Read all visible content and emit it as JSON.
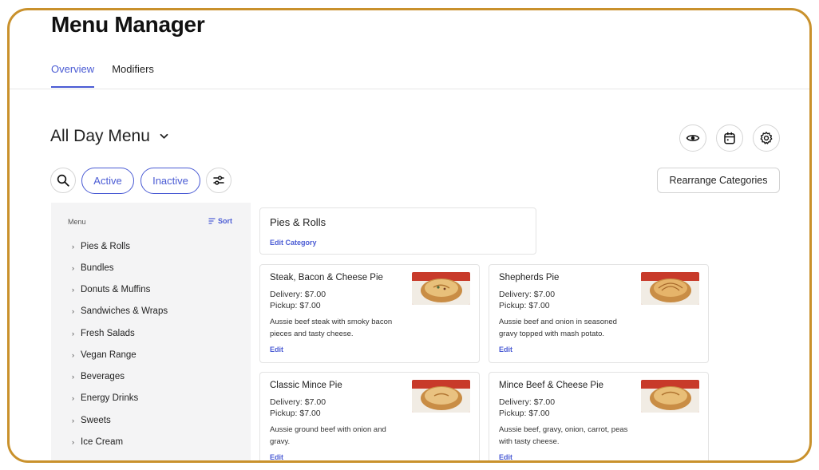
{
  "header": {
    "title": "Menu Manager"
  },
  "tabs": [
    {
      "label": "Overview"
    },
    {
      "label": "Modifiers"
    }
  ],
  "menu": {
    "title": "All Day Menu"
  },
  "filters": {
    "active": "Active",
    "inactive": "Inactive"
  },
  "actions": {
    "rearrange": "Rearrange Categories"
  },
  "sidebar": {
    "heading": "Menu",
    "sort_label": "Sort",
    "items": [
      {
        "label": "Pies & Rolls"
      },
      {
        "label": "Bundles"
      },
      {
        "label": "Donuts & Muffins"
      },
      {
        "label": "Sandwiches & Wraps"
      },
      {
        "label": "Fresh Salads"
      },
      {
        "label": "Vegan Range"
      },
      {
        "label": "Beverages"
      },
      {
        "label": "Energy Drinks"
      },
      {
        "label": "Sweets"
      },
      {
        "label": "Ice Cream"
      }
    ]
  },
  "category": {
    "name": "Pies & Rolls",
    "edit_label": "Edit Category"
  },
  "items": [
    {
      "name": "Steak, Bacon & Cheese Pie",
      "delivery": "Delivery: $7.00",
      "pickup": "Pickup: $7.00",
      "description": "Aussie beef steak with smoky bacon pieces and tasty cheese.",
      "edit": "Edit"
    },
    {
      "name": "Shepherds Pie",
      "delivery": "Delivery: $7.00",
      "pickup": "Pickup: $7.00",
      "description": "Aussie beef and onion in seasoned gravy topped with mash potato.",
      "edit": "Edit"
    },
    {
      "name": "Classic Mince Pie",
      "delivery": "Delivery: $7.00",
      "pickup": "Pickup: $7.00",
      "description": "Aussie ground beef with onion and gravy.",
      "edit": "Edit"
    },
    {
      "name": "Mince Beef & Cheese Pie",
      "delivery": "Delivery: $7.00",
      "pickup": "Pickup: $7.00",
      "description": "Aussie beef, gravy, onion, carrot, peas with tasty cheese.",
      "edit": "Edit"
    }
  ],
  "colors": {
    "accent": "#4a5bd4",
    "frame": "#c9912c",
    "sidebar_bg": "#f4f4f5"
  },
  "icons": {
    "menu_chevron": "chevron-down-icon",
    "preview": "eye-icon",
    "schedule": "calendar-icon",
    "settings": "gear-icon",
    "search": "search-icon",
    "filter": "sliders-icon",
    "sort": "sort-icon",
    "expand": "chevron-right-icon"
  }
}
